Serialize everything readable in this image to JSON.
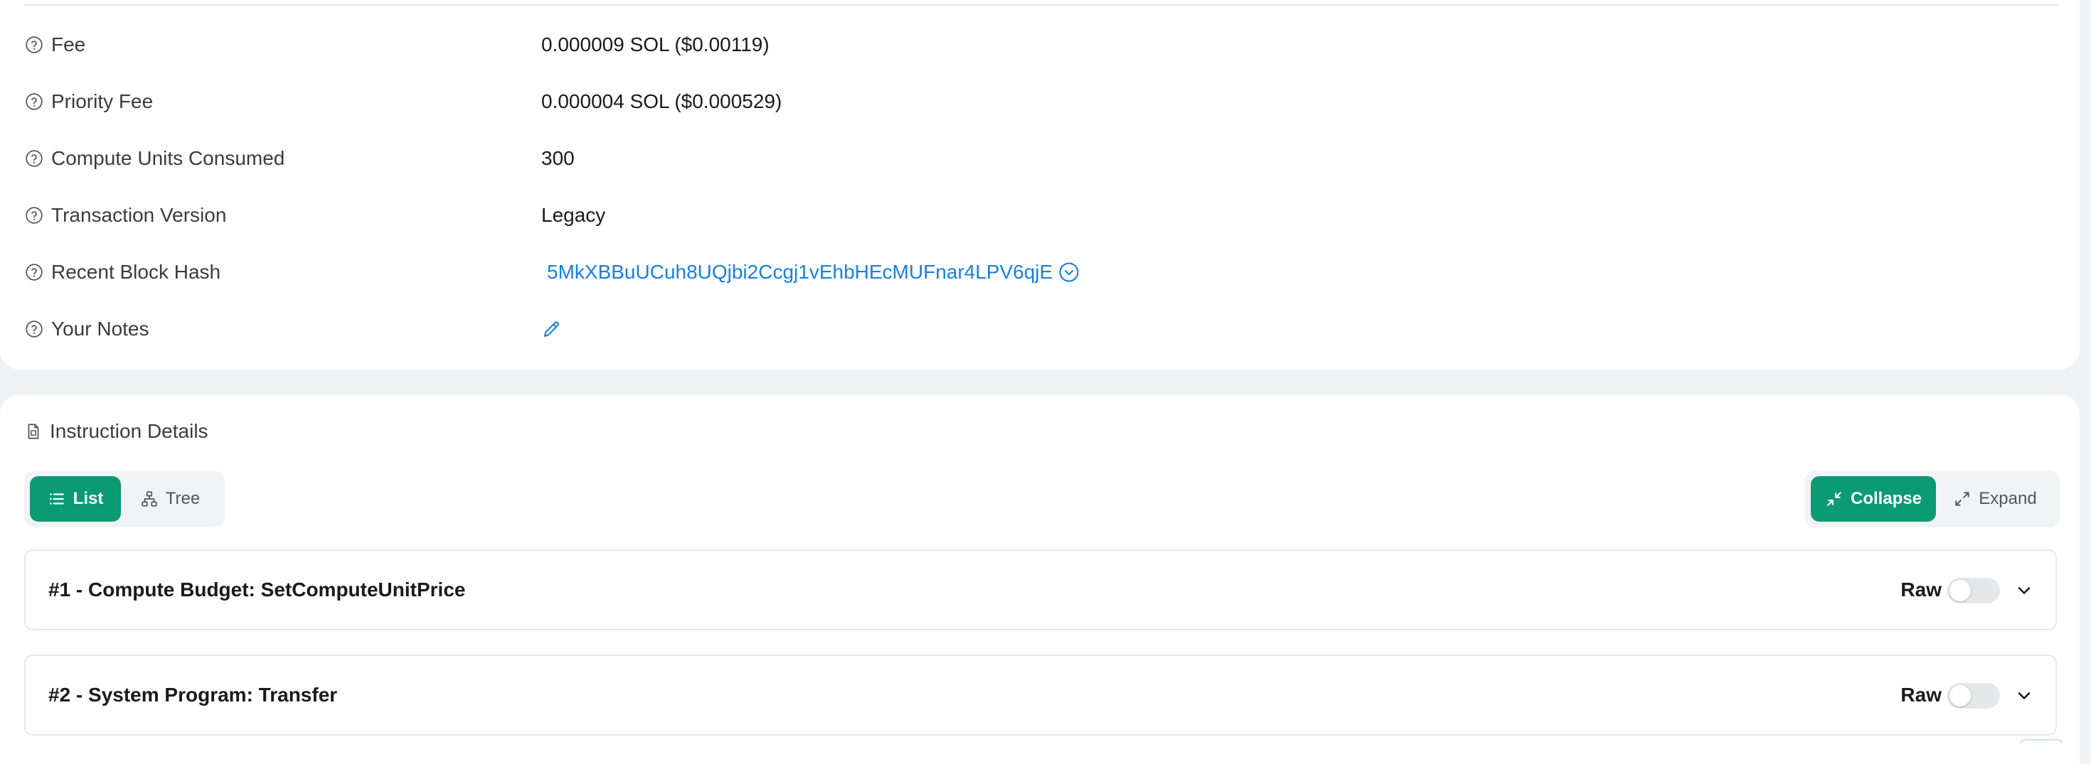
{
  "details": {
    "rows": [
      {
        "label": "Fee",
        "value": "0.000009 SOL ($0.00119)"
      },
      {
        "label": "Priority Fee",
        "value": "0.000004 SOL ($0.000529)"
      },
      {
        "label": "Compute Units Consumed",
        "value": "300"
      },
      {
        "label": "Transaction Version",
        "value": "Legacy"
      },
      {
        "label": "Recent Block Hash",
        "value": "5MkXBBuUCuh8UQjbi2Ccgj1vEhbHEcMUFnar4LPV6qjE"
      },
      {
        "label": "Your Notes",
        "value": ""
      }
    ]
  },
  "instructions": {
    "title": "Instruction Details",
    "view_toggle": {
      "list": "List",
      "tree": "Tree",
      "selected": "List"
    },
    "expand_toggle": {
      "collapse": "Collapse",
      "expand": "Expand",
      "selected": "Collapse"
    },
    "items": [
      {
        "title": "#1 - Compute Budget: SetComputeUnitPrice",
        "raw_label": "Raw",
        "raw_on": false
      },
      {
        "title": "#2 - System Program: Transfer",
        "raw_label": "Raw",
        "raw_on": false
      }
    ]
  },
  "colors": {
    "accent": "#0a9a74",
    "link": "#1a7fe0",
    "background": "#f0f1f3"
  },
  "icons": {
    "help": "question-circle-icon",
    "dropdown": "chevron-down-circle-icon",
    "edit": "pencil-icon",
    "doc": "document-icon",
    "list": "list-icon",
    "tree": "tree-icon",
    "collapse": "collapse-arrows-icon",
    "expand": "expand-arrows-icon",
    "chevron": "chevron-down-icon"
  }
}
